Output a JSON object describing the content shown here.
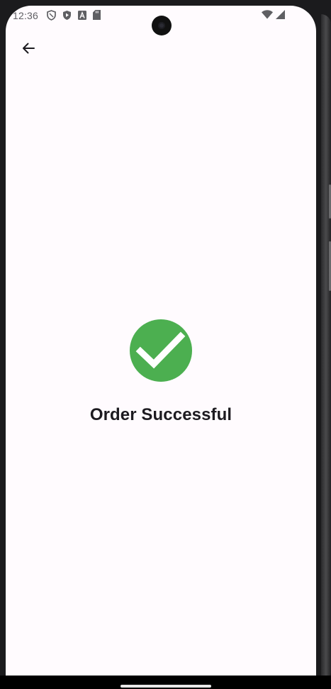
{
  "status_bar": {
    "time": "12:36",
    "left_icons": [
      "shield-outline-icon",
      "shield-play-icon",
      "font-a-icon",
      "sd-card-icon"
    ],
    "right_icons": [
      "wifi-icon",
      "signal-icon"
    ]
  },
  "toolbar": {
    "back_icon": "arrow-left-icon"
  },
  "confirmation": {
    "icon": "check-circle-icon",
    "icon_color": "#4caf50",
    "title": "Order Successful"
  },
  "colors": {
    "background": "#fffbfe",
    "text": "#1d1b20"
  }
}
